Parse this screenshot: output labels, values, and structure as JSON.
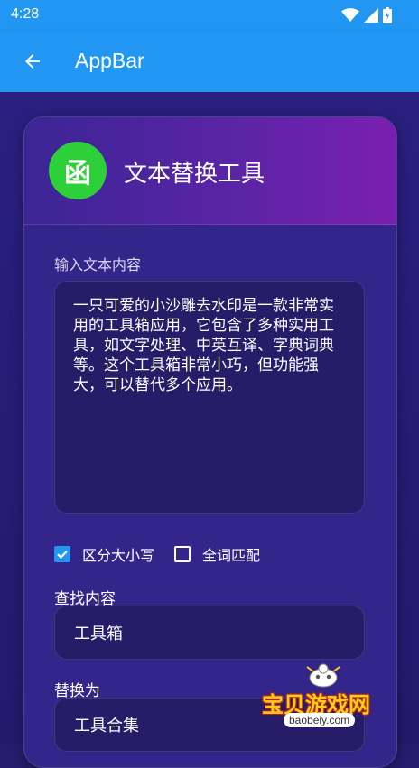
{
  "status_bar": {
    "time": "4:28",
    "icons": [
      "wifi-icon",
      "signal-icon",
      "battery-icon"
    ]
  },
  "app_bar": {
    "back_icon": "arrow-back-icon",
    "title": "AppBar",
    "color": "#2196f3"
  },
  "card": {
    "icon_glyph": "函",
    "icon_color": "#2ed03a",
    "title": "文本替换工具",
    "input_label": "输入文本内容",
    "input_text": "一只可爱的小沙雕去水印是一款非常实用的工具箱应用，它包含了多种实用工具，如文字处理、中英互译、字典词典等。这个工具箱非常小巧，但功能强大，可以替代多个应用。",
    "options": [
      {
        "label": "区分大小写",
        "checked": true
      },
      {
        "label": "全词匹配",
        "checked": false
      }
    ],
    "find_label": "查找内容",
    "find_value": "工具箱",
    "replace_label": "替换为",
    "replace_value": "工具合集"
  },
  "watermark": {
    "text": "宝贝游戏网",
    "url": "baobeiy.com"
  }
}
